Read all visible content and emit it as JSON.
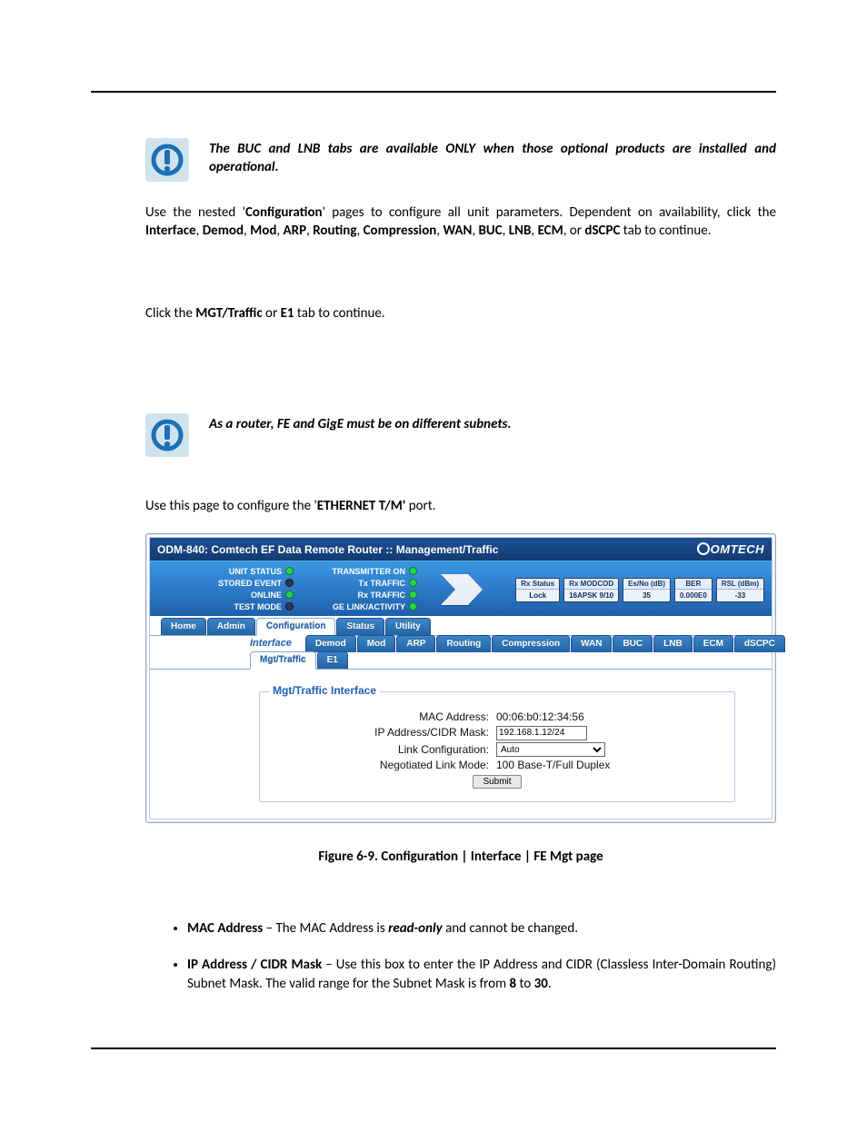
{
  "notice1": "The BUC and LNB tabs are available ONLY when those optional products are installed and operational.",
  "para1_a": "Use the nested '",
  "para1_b": "Configuration",
  "para1_c": "' pages to configure all unit parameters. Dependent on availability, click the ",
  "para1_list": "Interface, Demod, Mod, ARP, Routing, Compression, WAN, BUC, LNB, ECM, or dSCPC",
  "para1_tail": " tab to continue.",
  "para1_parts": [
    "Interface",
    ", ",
    "Demod",
    ", ",
    "Mod",
    ", ",
    "ARP",
    ", ",
    "Routing",
    ", ",
    "Compression",
    ", ",
    "WAN",
    ", ",
    "BUC",
    ", ",
    "LNB",
    ", ",
    "ECM",
    ", or ",
    "dSCPC"
  ],
  "para2_a": "Click the ",
  "para2_b": "MGT/Traffic",
  "para2_c": " or ",
  "para2_d": "E1",
  "para2_e": " tab to continue.",
  "notice2": "As a router, FE and GigE must be on different subnets.",
  "para3_a": "Use this page to configure the '",
  "para3_b": "ETHERNET T/M'",
  "para3_c": "  port.",
  "figcap": "Figure 6-9. Configuration | Interface | FE Mgt page",
  "bullets": {
    "b1_lead": "MAC Address",
    "b1_mid": " – The MAC Address is ",
    "b1_em": "read-only",
    "b1_tail": " and cannot be changed.",
    "b2_lead": "IP Address / CIDR Mask",
    "b2_mid": " – Use this box to enter the IP Address and CIDR (Classless Inter-Domain Routing) Subnet Mask. The valid range for the Subnet Mask is from ",
    "b2_n1": "8",
    "b2_to": " to ",
    "b2_n2": "30",
    "b2_tail": "."
  },
  "shot": {
    "title": "ODM-840: Comtech EF Data Remote Router :: Management/Traffic",
    "brand": "OMTECH",
    "status_left": [
      "UNIT STATUS",
      "STORED EVENT",
      "ONLINE",
      "TEST MODE"
    ],
    "status_left_dots": [
      "green",
      "dark",
      "green",
      "dark"
    ],
    "status_mid": [
      "TRANSMITTER ON",
      "Tx TRAFFIC",
      "Rx TRAFFIC",
      "GE LINK/ACTIVITY"
    ],
    "status_mid_dots": [
      "green",
      "green",
      "green",
      "green"
    ],
    "rx": [
      {
        "h": "Rx Status",
        "v": "Lock"
      },
      {
        "h": "Rx MODCOD",
        "v": "16APSK 9/10"
      },
      {
        "h": "Es/No (dB)",
        "v": "35"
      },
      {
        "h": "BER",
        "v": "0.000E0"
      },
      {
        "h": "RSL (dBm)",
        "v": "-33"
      }
    ],
    "tabs1": [
      "Home",
      "Admin",
      "Configuration",
      "Status",
      "Utility"
    ],
    "tabs1_active": 2,
    "tabs2_lead": "Interface",
    "tabs2": [
      "Demod",
      "Mod",
      "ARP",
      "Routing",
      "Compression",
      "WAN",
      "BUC",
      "LNB",
      "ECM",
      "dSCPC"
    ],
    "tabs3": [
      "Mgt/Traffic",
      "E1"
    ],
    "tabs3_active": 0,
    "panel": {
      "legend": "Mgt/Traffic Interface",
      "rows": {
        "mac_l": "MAC Address:",
        "mac_v": "00:06:b0:12:34:56",
        "ip_l": "IP Address/CIDR Mask:",
        "ip_v": "192.168.1.12/24",
        "lc_l": "Link Configuration:",
        "lc_v": "Auto",
        "nl_l": "Negotiated Link Mode:",
        "nl_v": "100 Base-T/Full Duplex",
        "submit": "Submit"
      }
    }
  }
}
